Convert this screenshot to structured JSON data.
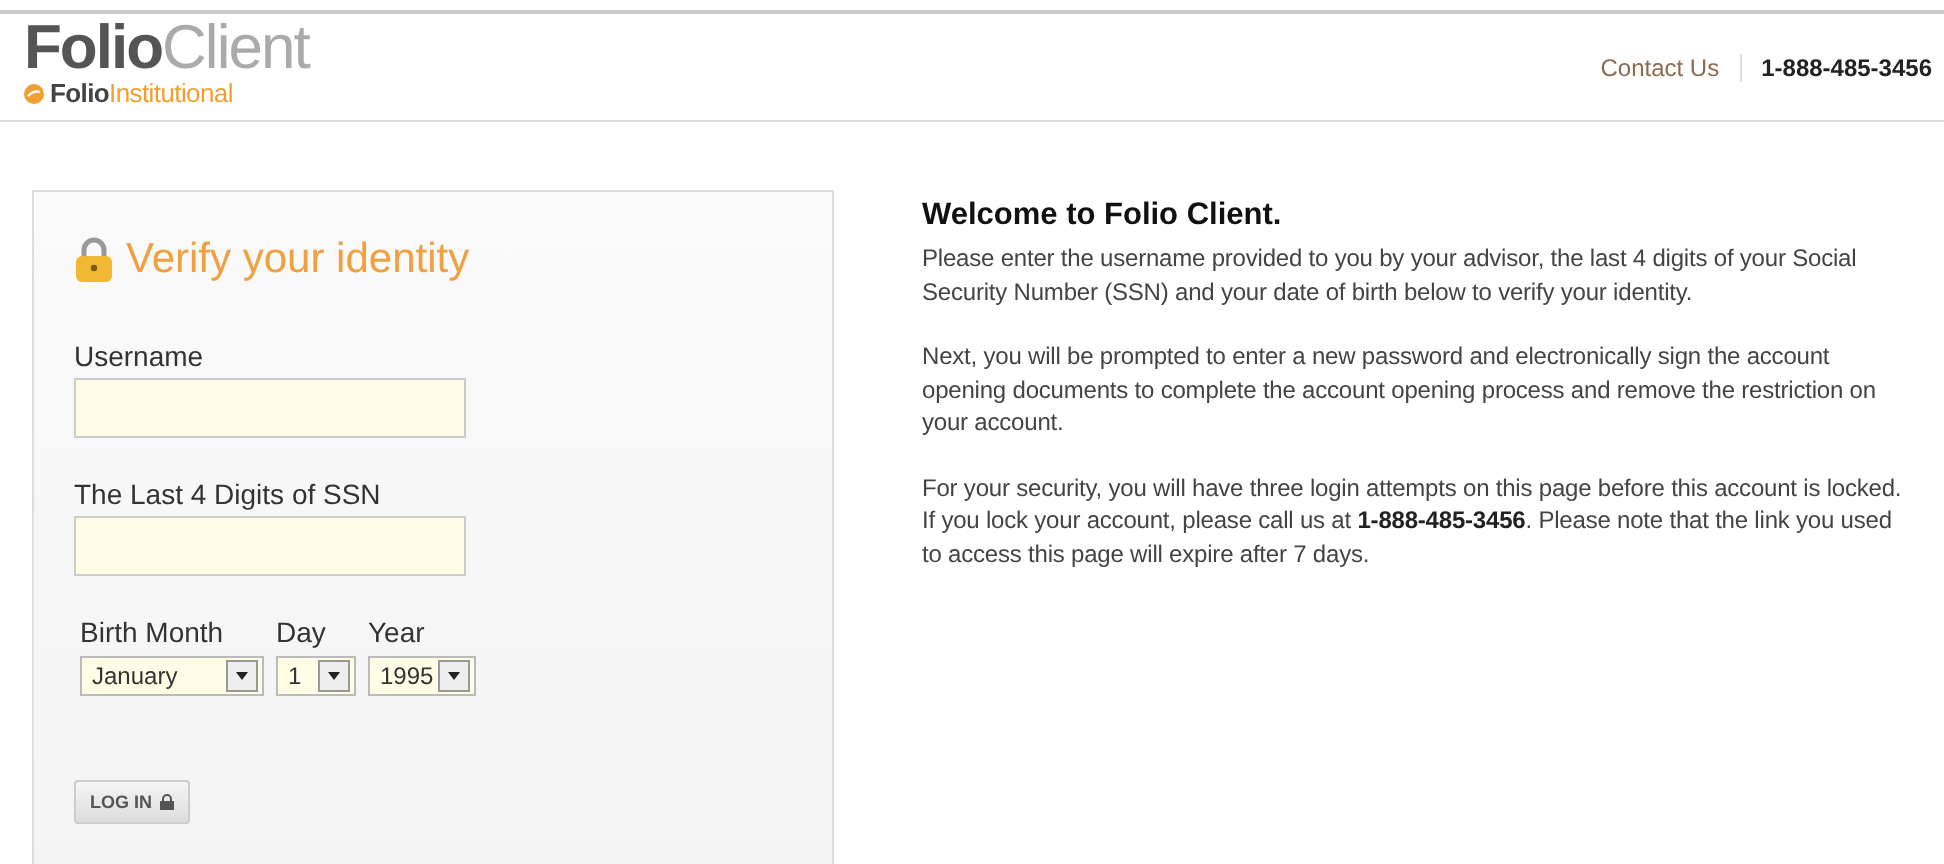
{
  "header": {
    "logo": "**Folio**Client",
    "sublogo": "**Folio**Institutional",
    "contact_link": "Contact Us",
    "phone": "1-888-485-3456"
  },
  "verify_form": {
    "title": "Verify your identity",
    "fields": [
      {
        "label": "Username"
      },
      {
        "label": "The Last 4 Digits of SSN"
      }
    ],
    "birth_date": [
      {
        "label": "Birth Month",
        "value": "January"
      },
      {
        "label": "Day",
        "value": "1"
      },
      {
        "label": "Year",
        "value": "1995"
      }
    ],
    "button": "LOG IN"
  },
  "welcome": {
    "heading": "Welcome to Folio Client.",
    "paragraphs": [
      "Please enter the username provided to you by your advisor, the last 4 digits of your Social Security Number (SSN) and your date of birth below to verify your identity.",
      "Next, you will be prompted to enter a new password and electronically sign the account opening documents to complete the account opening process and remove the restriction on your account.",
      "For your security, you will have three login attempts on this page before this account is locked. If you lock your account, please call us at **1-888-485-3456**. Please note that the link you used to access this page will expire after 7 days."
    ]
  }
}
